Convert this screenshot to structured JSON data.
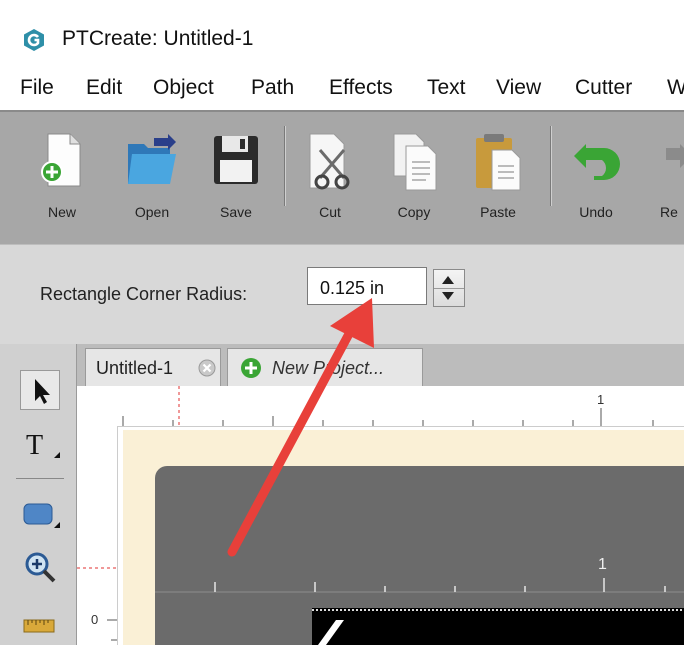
{
  "window": {
    "title": "PTCreate: Untitled-1"
  },
  "menu": [
    "File",
    "Edit",
    "Object",
    "Path",
    "Effects",
    "Text",
    "View",
    "Cutter",
    "W"
  ],
  "toolbar": {
    "buttons": [
      {
        "label": "New",
        "icon": "new-document-icon"
      },
      {
        "label": "Open",
        "icon": "open-folder-icon"
      },
      {
        "label": "Save",
        "icon": "save-disk-icon"
      },
      {
        "label": "Cut",
        "icon": "cut-scissors-icon"
      },
      {
        "label": "Copy",
        "icon": "copy-icon"
      },
      {
        "label": "Paste",
        "icon": "paste-clipboard-icon"
      },
      {
        "label": "Undo",
        "icon": "undo-arrow-icon"
      },
      {
        "label": "Re",
        "icon": "redo-arrow-icon"
      }
    ]
  },
  "options": {
    "corner_radius_label": "Rectangle Corner Radius:",
    "corner_radius_value": "0.125 in"
  },
  "tabs": [
    {
      "label": "Untitled-1"
    },
    {
      "label": "New Project..."
    }
  ],
  "rulers": {
    "top_mark": "1",
    "left_mark": "0",
    "mat_mark": "1"
  },
  "colors": {
    "annotation_arrow": "#e8403a",
    "mat": "#faf0d6",
    "cutting_mat": "#6b6b6b",
    "toolbar": "#a7a7a7"
  }
}
